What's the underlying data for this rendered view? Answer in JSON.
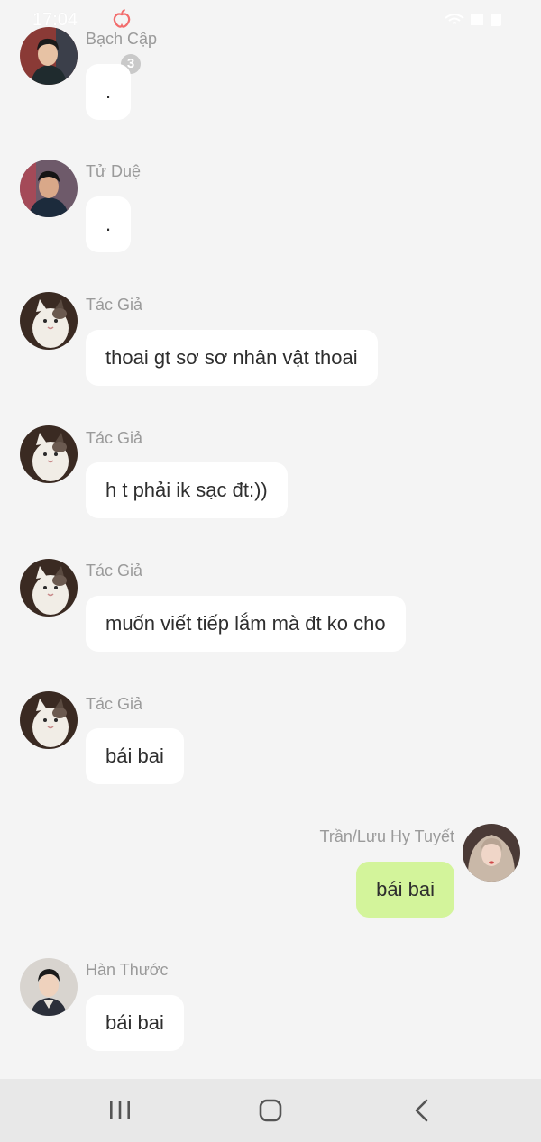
{
  "status_bar": {
    "time": "17:04",
    "unread_count": "3"
  },
  "messages": [
    {
      "sender": "Bạch Cập",
      "text": "."
    },
    {
      "sender": "Tử Duệ",
      "text": "."
    },
    {
      "sender": "Tác Giả",
      "text": "thoai gt sơ sơ nhân vật thoai"
    },
    {
      "sender": "Tác Giả",
      "text": "h t phải ik sạc đt:))"
    },
    {
      "sender": "Tác Giả",
      "text": "muốn viết tiếp lắm mà đt ko cho"
    },
    {
      "sender": "Tác Giả",
      "text": "bái bai"
    },
    {
      "sender": "Trần/Lưu Hy Tuyết",
      "text": "bái bai"
    },
    {
      "sender": "Hàn Thước",
      "text": "bái bai"
    }
  ],
  "colors": {
    "background": "#f4f4f4",
    "bubble": "#ffffff",
    "own_bubble": "#d3f49b",
    "sender_name": "#9a9a9a",
    "nav_bar": "#e8e8e8"
  },
  "icons": {
    "status": [
      "peach-icon",
      "wifi-icon",
      "signal-icon",
      "battery-icon"
    ],
    "nav": [
      "recent-apps-icon",
      "home-icon",
      "back-icon"
    ]
  }
}
